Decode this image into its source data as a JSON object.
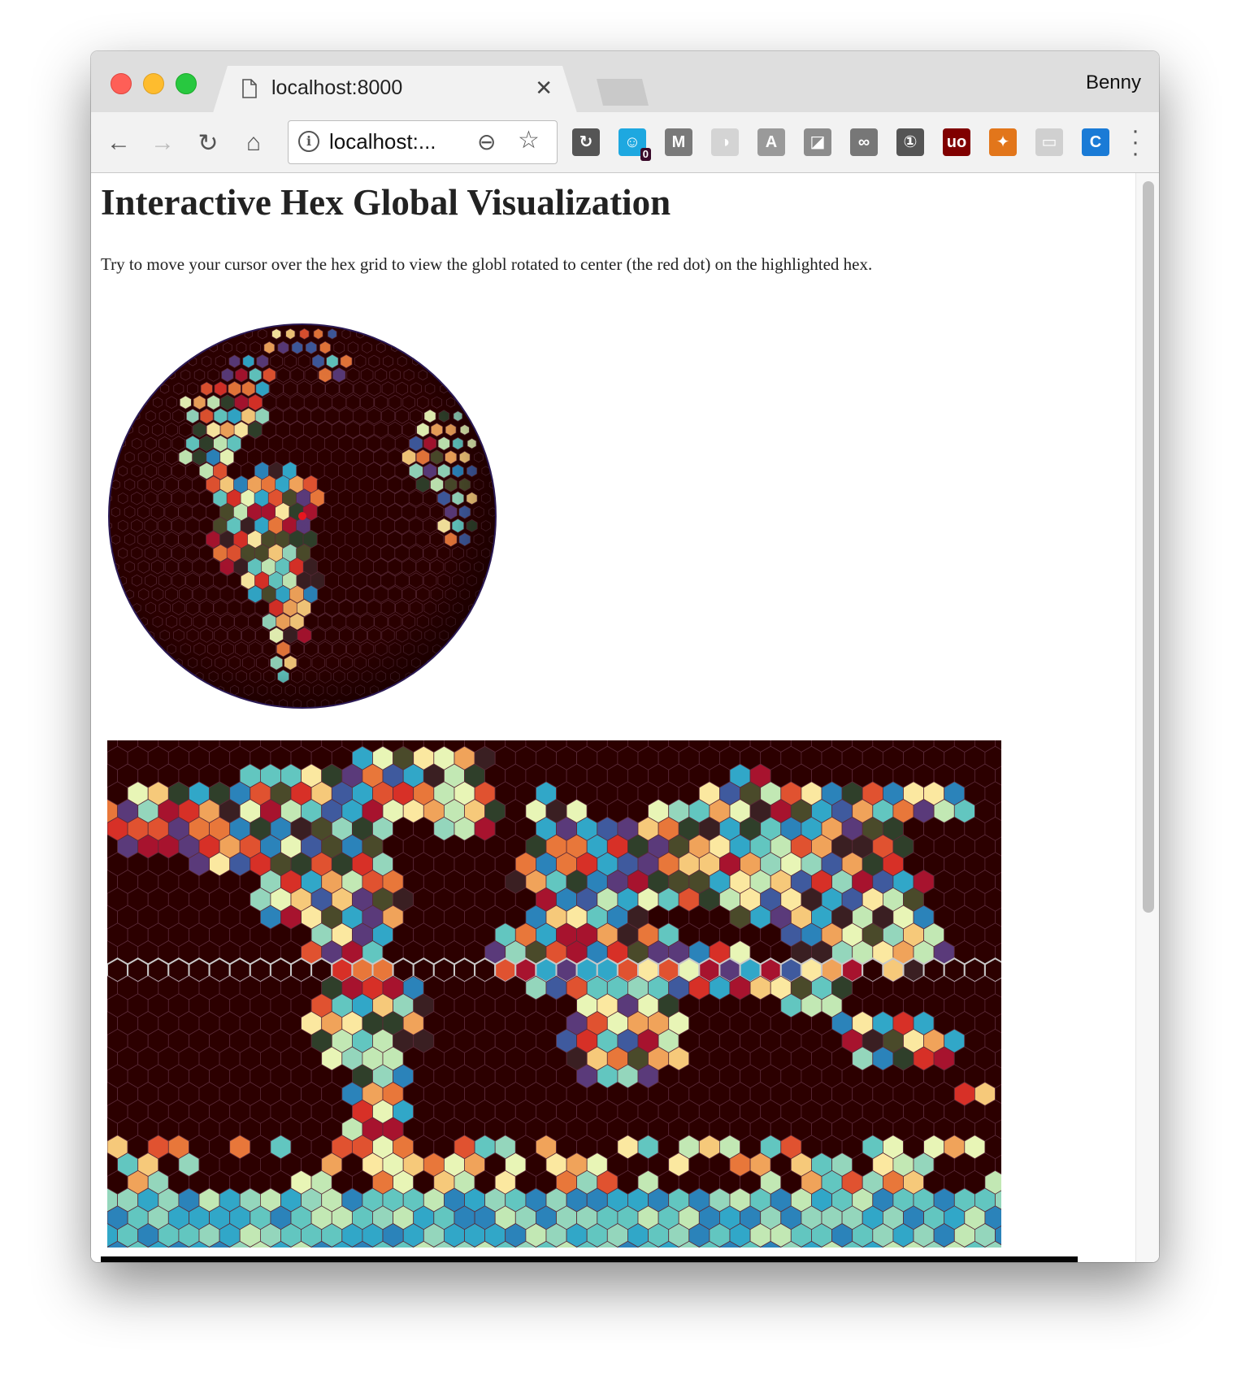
{
  "browser": {
    "tab_title": "localhost:8000",
    "profile_name": "Benny",
    "url": "localhost:...",
    "extensions": [
      {
        "name": "sync-icon",
        "color": "#555555",
        "glyph": "↻"
      },
      {
        "name": "ghostery-icon",
        "color": "#1ea8e0",
        "glyph": "☺",
        "badge": "0"
      },
      {
        "name": "m-icon",
        "color": "#7a7a7a",
        "glyph": "M"
      },
      {
        "name": "pie-icon",
        "color": "#d4d4d4",
        "glyph": "◑"
      },
      {
        "name": "a-icon",
        "color": "#9a9a9a",
        "glyph": "A"
      },
      {
        "name": "square-icon",
        "color": "#8c8c8c",
        "glyph": "◪"
      },
      {
        "name": "glasses-icon",
        "color": "#777777",
        "glyph": "∞"
      },
      {
        "name": "onepassword-icon",
        "color": "#555555",
        "glyph": "①"
      },
      {
        "name": "ublock-icon",
        "color": "#800000",
        "glyph": "uo"
      },
      {
        "name": "fox-icon",
        "color": "#e2761b",
        "glyph": "✦"
      },
      {
        "name": "chat-icon",
        "color": "#d0d0d0",
        "glyph": "▭"
      },
      {
        "name": "c-icon",
        "color": "#1a7bd6",
        "glyph": "C"
      }
    ]
  },
  "page": {
    "title": "Interactive Hex Global Visualization",
    "description": "Try to move your cursor over the hex grid to view the globl rotated to center (the red dot) on the highlighted hex."
  },
  "colors": {
    "ocean": "#2c0000",
    "hex_stroke": "#5a2a38",
    "highlight_row_stroke": "#c8c8c8",
    "globe_outline": "#2b1a55",
    "center_dot": "#e8161f",
    "palette": [
      "#a7132e",
      "#d73027",
      "#e05230",
      "#e8773a",
      "#f0a35a",
      "#f6c97a",
      "#fbe8a0",
      "#e8f5b6",
      "#c2e8b4",
      "#94d6bc",
      "#62c6c0",
      "#31a7c8",
      "#2b83ba",
      "#3f5a9e",
      "#5a3a7a",
      "#4a4a2a",
      "#2f3f2a",
      "#3a1f22"
    ]
  }
}
